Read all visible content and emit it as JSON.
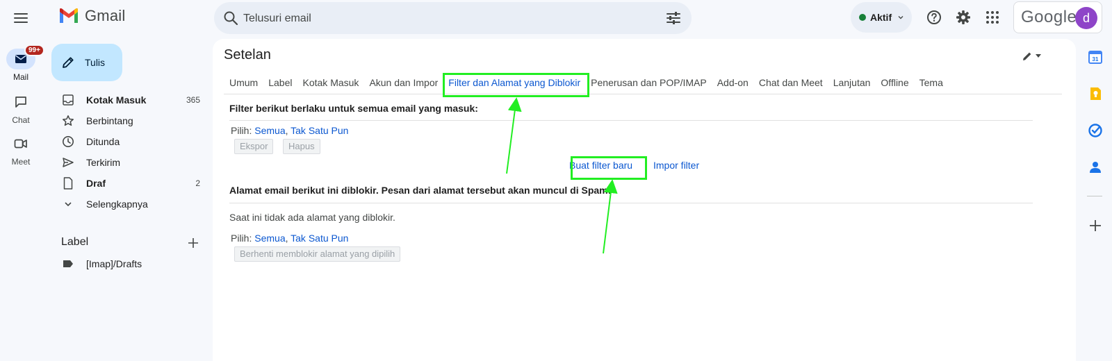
{
  "header": {
    "app_name": "Gmail",
    "search_placeholder": "Telusuri email",
    "status_label": "Aktif",
    "account_word": "Google",
    "avatar_letter": "d"
  },
  "rail": [
    {
      "label": "Mail",
      "badge": "99+"
    },
    {
      "label": "Chat"
    },
    {
      "label": "Meet"
    }
  ],
  "sidebar": {
    "compose_label": "Tulis",
    "items": [
      {
        "label": "Kotak Masuk",
        "count": "365"
      },
      {
        "label": "Berbintang",
        "count": ""
      },
      {
        "label": "Ditunda",
        "count": ""
      },
      {
        "label": "Terkirim",
        "count": ""
      },
      {
        "label": "Draf",
        "count": "2"
      },
      {
        "label": "Selengkapnya",
        "count": ""
      }
    ],
    "label_heading": "Label",
    "labels": [
      {
        "label": "[Imap]/Drafts"
      }
    ]
  },
  "settings": {
    "title": "Setelan",
    "tabs": [
      "Umum",
      "Label",
      "Kotak Masuk",
      "Akun dan Impor",
      "Filter dan Alamat yang Diblokir",
      "Penerusan dan POP/IMAP",
      "Add-on",
      "Chat dan Meet",
      "Lanjutan",
      "Offline",
      "Tema"
    ],
    "active_tab_index": 4,
    "filters": {
      "heading": "Filter berikut berlaku untuk semua email yang masuk:",
      "pick_label": "Pilih:",
      "pick_all": "Semua",
      "pick_separator": ",",
      "pick_none": "Tak Satu Pun",
      "export_label": "Ekspor",
      "delete_label": "Hapus",
      "create_label": "Buat filter baru",
      "import_label": "Impor filter"
    },
    "blocked": {
      "heading": "Alamat email berikut ini diblokir. Pesan dari alamat tersebut akan muncul di Spam:",
      "empty_text": "Saat ini tidak ada alamat yang diblokir.",
      "pick_label": "Pilih:",
      "pick_all": "Semua",
      "pick_separator": ",",
      "pick_none": "Tak Satu Pun",
      "unblock_label": "Berhenti memblokir alamat yang dipilih"
    }
  },
  "colors": {
    "highlight": "#22ee22",
    "link": "#0b57d0",
    "compose_bg": "#c2e7ff",
    "status_dot": "#188038",
    "badge": "#b3261e"
  }
}
